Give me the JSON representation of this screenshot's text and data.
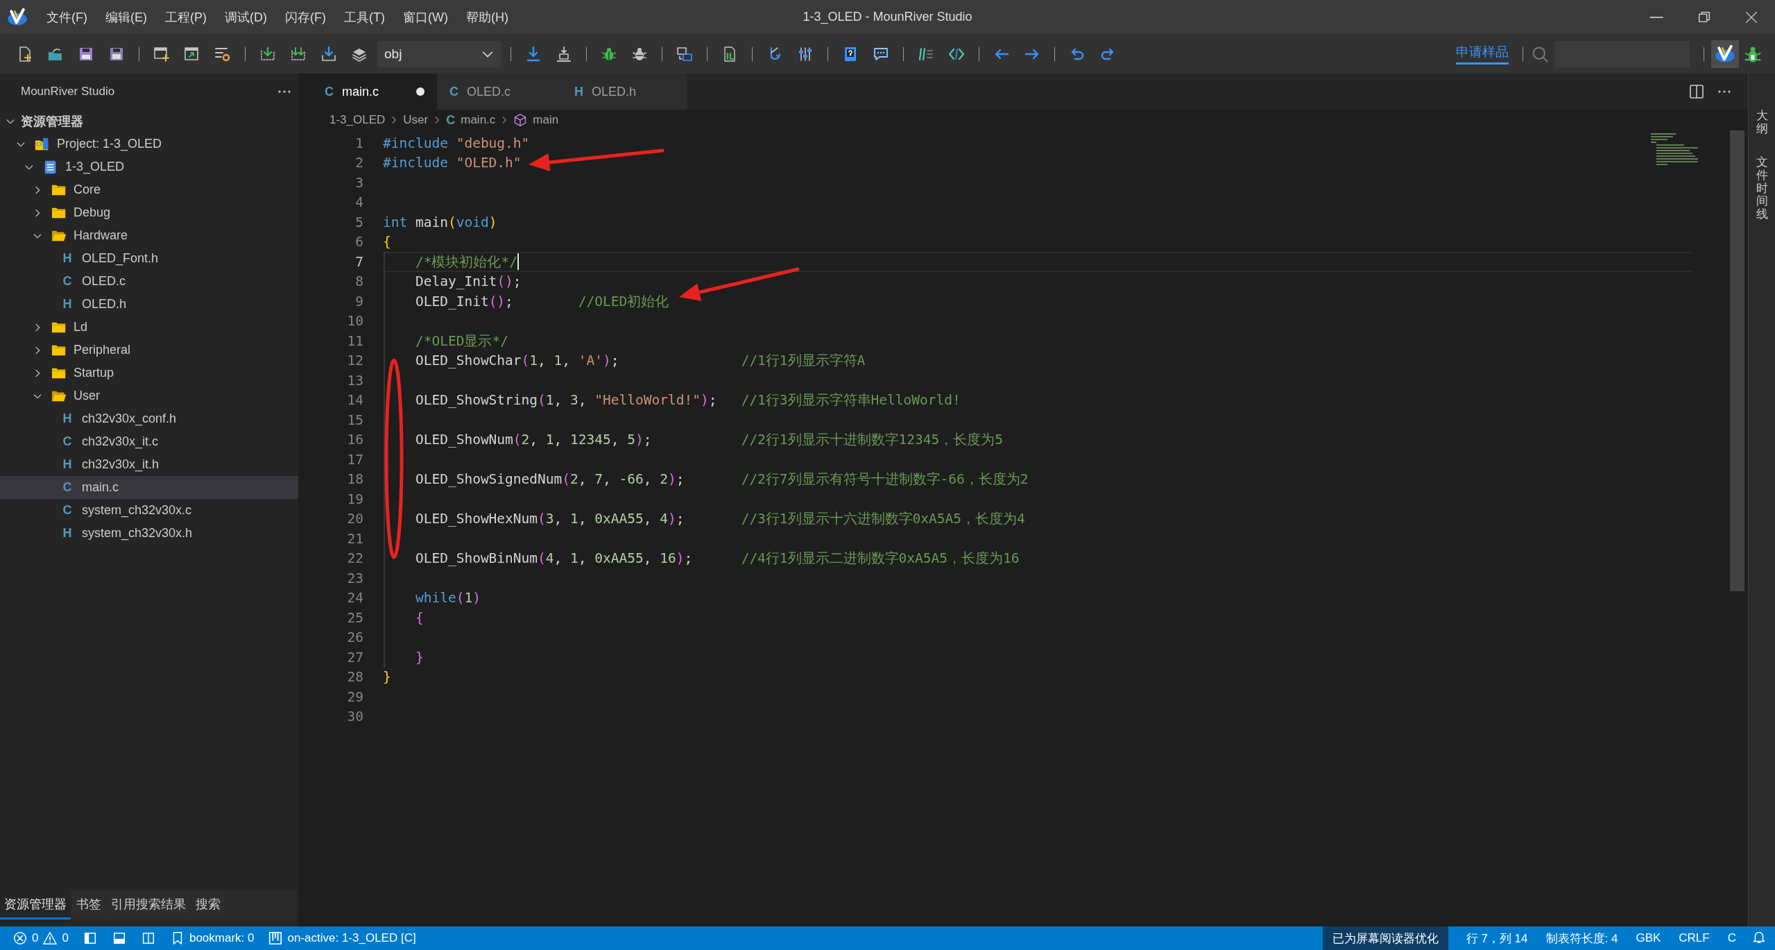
{
  "window": {
    "title": "1-3_OLED - MounRiver Studio"
  },
  "menu": [
    "文件(F)",
    "编辑(E)",
    "工程(P)",
    "调试(D)",
    "闪存(F)",
    "工具(T)",
    "窗口(W)",
    "帮助(H)"
  ],
  "toolbar": {
    "build_config": "obj",
    "sample_link": "申请样品"
  },
  "sidebar": {
    "title": "MounRiver Studio",
    "section": {
      "label": "资源管理器",
      "expanded": true
    },
    "tree": [
      {
        "label": "Project: 1-3_OLED",
        "kind": "project",
        "expanded": true,
        "selected": false,
        "children": [
          {
            "label": "1-3_OLED",
            "kind": "config",
            "expanded": true,
            "selected": false,
            "children": [
              {
                "label": "Core",
                "kind": "folder",
                "expanded": false,
                "selected": false
              },
              {
                "label": "Debug",
                "kind": "folder",
                "expanded": false,
                "selected": false
              },
              {
                "label": "Hardware",
                "kind": "folder",
                "expanded": true,
                "selected": false,
                "children": [
                  {
                    "label": "OLED_Font.h",
                    "kind": "file",
                    "icon": "H",
                    "selected": false
                  },
                  {
                    "label": "OLED.c",
                    "kind": "file",
                    "icon": "C",
                    "selected": false
                  },
                  {
                    "label": "OLED.h",
                    "kind": "file",
                    "icon": "H",
                    "selected": false
                  }
                ]
              },
              {
                "label": "Ld",
                "kind": "folder",
                "expanded": false,
                "selected": false
              },
              {
                "label": "Peripheral",
                "kind": "folder",
                "expanded": false,
                "selected": false
              },
              {
                "label": "Startup",
                "kind": "folder",
                "expanded": false,
                "selected": false
              },
              {
                "label": "User",
                "kind": "folder",
                "expanded": true,
                "selected": false,
                "children": [
                  {
                    "label": "ch32v30x_conf.h",
                    "kind": "file",
                    "icon": "H",
                    "selected": false
                  },
                  {
                    "label": "ch32v30x_it.c",
                    "kind": "file",
                    "icon": "C",
                    "selected": false
                  },
                  {
                    "label": "ch32v30x_it.h",
                    "kind": "file",
                    "icon": "H",
                    "selected": false
                  },
                  {
                    "label": "main.c",
                    "kind": "file",
                    "icon": "C",
                    "selected": true
                  },
                  {
                    "label": "system_ch32v30x.c",
                    "kind": "file",
                    "icon": "C",
                    "selected": false
                  },
                  {
                    "label": "system_ch32v30x.h",
                    "kind": "file",
                    "icon": "H",
                    "selected": false
                  }
                ]
              }
            ]
          }
        ]
      }
    ],
    "tabs": [
      {
        "label": "资源管理器",
        "selected": true
      },
      {
        "label": "书签",
        "selected": false
      },
      {
        "label": "引用搜索结果",
        "selected": false
      },
      {
        "label": "搜索",
        "selected": false
      }
    ]
  },
  "editor": {
    "tabs": [
      {
        "label": "main.c",
        "icon": "C",
        "selected": true,
        "modified": true
      },
      {
        "label": "OLED.c",
        "icon": "C",
        "selected": false,
        "modified": false
      },
      {
        "label": "OLED.h",
        "icon": "H",
        "selected": false,
        "modified": false
      }
    ],
    "breadcrumb": [
      {
        "label": "1-3_OLED",
        "kind": "folder"
      },
      {
        "label": "User",
        "kind": "folder"
      },
      {
        "label": "main.c",
        "kind": "file",
        "icon": "C"
      },
      {
        "label": "main",
        "kind": "symbol"
      }
    ],
    "lines": [
      {
        "number": "1",
        "current": false,
        "tokens": [
          {
            "kind": "keyword",
            "text": "#include"
          },
          {
            "kind": "string",
            "text": " \"debug.h\""
          }
        ]
      },
      {
        "number": "2",
        "current": false,
        "tokens": [
          {
            "kind": "keyword",
            "text": "#include"
          },
          {
            "kind": "string",
            "text": " \"OLED.h\""
          }
        ]
      },
      {
        "number": "3",
        "current": false
      },
      {
        "number": "4",
        "current": false
      },
      {
        "number": "5",
        "current": false,
        "tokens": [
          {
            "kind": "keyword",
            "text": "int"
          },
          {
            "kind": "plain",
            "text": " main"
          },
          {
            "kind": "bracket1",
            "text": "("
          },
          {
            "kind": "keyword",
            "text": "void"
          },
          {
            "kind": "bracket1",
            "text": ")"
          }
        ]
      },
      {
        "number": "6",
        "current": false,
        "tokens": [
          {
            "kind": "bracket1",
            "text": "{"
          }
        ]
      },
      {
        "number": "7",
        "current": true,
        "tokens": [
          {
            "kind": "comment",
            "text": "    /*模块初始化*/"
          }
        ]
      },
      {
        "number": "8",
        "current": false,
        "tokens": [
          {
            "kind": "plain",
            "text": "    Delay_Init"
          },
          {
            "kind": "bracket2",
            "text": "()"
          },
          {
            "kind": "plain",
            "text": ";"
          }
        ]
      },
      {
        "number": "9",
        "current": false,
        "tokens": [
          {
            "kind": "plain",
            "text": "    OLED_Init"
          },
          {
            "kind": "bracket2",
            "text": "()"
          },
          {
            "kind": "plain",
            "text": ";        "
          },
          {
            "kind": "comment",
            "text": "//OLED初始化"
          }
        ]
      },
      {
        "number": "10",
        "current": false
      },
      {
        "number": "11",
        "current": false,
        "tokens": [
          {
            "kind": "comment",
            "text": "    /*OLED显示*/"
          }
        ]
      },
      {
        "number": "12",
        "current": false,
        "tokens": [
          {
            "kind": "plain",
            "text": "    OLED_ShowChar"
          },
          {
            "kind": "bracket2",
            "text": "("
          },
          {
            "kind": "number",
            "text": "1"
          },
          {
            "kind": "plain",
            "text": ", "
          },
          {
            "kind": "number",
            "text": "1"
          },
          {
            "kind": "plain",
            "text": ", "
          },
          {
            "kind": "string",
            "text": "'A'"
          },
          {
            "kind": "bracket2",
            "text": ")"
          },
          {
            "kind": "plain",
            "text": ";               "
          },
          {
            "kind": "comment",
            "text": "//1行1列显示字符A"
          }
        ]
      },
      {
        "number": "13",
        "current": false
      },
      {
        "number": "14",
        "current": false,
        "tokens": [
          {
            "kind": "plain",
            "text": "    OLED_ShowString"
          },
          {
            "kind": "bracket2",
            "text": "("
          },
          {
            "kind": "number",
            "text": "1"
          },
          {
            "kind": "plain",
            "text": ", "
          },
          {
            "kind": "number",
            "text": "3"
          },
          {
            "kind": "plain",
            "text": ", "
          },
          {
            "kind": "string",
            "text": "\"HelloWorld!\""
          },
          {
            "kind": "bracket2",
            "text": ")"
          },
          {
            "kind": "plain",
            "text": ";   "
          },
          {
            "kind": "comment",
            "text": "//1行3列显示字符串HelloWorld!"
          }
        ]
      },
      {
        "number": "15",
        "current": false
      },
      {
        "number": "16",
        "current": false,
        "tokens": [
          {
            "kind": "plain",
            "text": "    OLED_ShowNum"
          },
          {
            "kind": "bracket2",
            "text": "("
          },
          {
            "kind": "number",
            "text": "2"
          },
          {
            "kind": "plain",
            "text": ", "
          },
          {
            "kind": "number",
            "text": "1"
          },
          {
            "kind": "plain",
            "text": ", "
          },
          {
            "kind": "number",
            "text": "12345"
          },
          {
            "kind": "plain",
            "text": ", "
          },
          {
            "kind": "number",
            "text": "5"
          },
          {
            "kind": "bracket2",
            "text": ")"
          },
          {
            "kind": "plain",
            "text": ";           "
          },
          {
            "kind": "comment",
            "text": "//2行1列显示十进制数字12345，长度为5"
          }
        ]
      },
      {
        "number": "17",
        "current": false
      },
      {
        "number": "18",
        "current": false,
        "tokens": [
          {
            "kind": "plain",
            "text": "    OLED_ShowSignedNum"
          },
          {
            "kind": "bracket2",
            "text": "("
          },
          {
            "kind": "number",
            "text": "2"
          },
          {
            "kind": "plain",
            "text": ", "
          },
          {
            "kind": "number",
            "text": "7"
          },
          {
            "kind": "plain",
            "text": ", "
          },
          {
            "kind": "number",
            "text": "-66"
          },
          {
            "kind": "plain",
            "text": ", "
          },
          {
            "kind": "number",
            "text": "2"
          },
          {
            "kind": "bracket2",
            "text": ")"
          },
          {
            "kind": "plain",
            "text": ";       "
          },
          {
            "kind": "comment",
            "text": "//2行7列显示有符号十进制数字-66，长度为2"
          }
        ]
      },
      {
        "number": "19",
        "current": false
      },
      {
        "number": "20",
        "current": false,
        "tokens": [
          {
            "kind": "plain",
            "text": "    OLED_ShowHexNum"
          },
          {
            "kind": "bracket2",
            "text": "("
          },
          {
            "kind": "number",
            "text": "3"
          },
          {
            "kind": "plain",
            "text": ", "
          },
          {
            "kind": "number",
            "text": "1"
          },
          {
            "kind": "plain",
            "text": ", "
          },
          {
            "kind": "number",
            "text": "0xAA55"
          },
          {
            "kind": "plain",
            "text": ", "
          },
          {
            "kind": "number",
            "text": "4"
          },
          {
            "kind": "bracket2",
            "text": ")"
          },
          {
            "kind": "plain",
            "text": ";       "
          },
          {
            "kind": "comment",
            "text": "//3行1列显示十六进制数字0xA5A5，长度为4"
          }
        ]
      },
      {
        "number": "21",
        "current": false
      },
      {
        "number": "22",
        "current": false,
        "tokens": [
          {
            "kind": "plain",
            "text": "    OLED_ShowBinNum"
          },
          {
            "kind": "bracket2",
            "text": "("
          },
          {
            "kind": "number",
            "text": "4"
          },
          {
            "kind": "plain",
            "text": ", "
          },
          {
            "kind": "number",
            "text": "1"
          },
          {
            "kind": "plain",
            "text": ", "
          },
          {
            "kind": "number",
            "text": "0xAA55"
          },
          {
            "kind": "plain",
            "text": ", "
          },
          {
            "kind": "number",
            "text": "16"
          },
          {
            "kind": "bracket2",
            "text": ")"
          },
          {
            "kind": "plain",
            "text": ";      "
          },
          {
            "kind": "comment",
            "text": "//4行1列显示二进制数字0xA5A5，长度为16"
          }
        ]
      },
      {
        "number": "23",
        "current": false
      },
      {
        "number": "24",
        "current": false,
        "tokens": [
          {
            "kind": "keyword",
            "text": "    while"
          },
          {
            "kind": "bracket2",
            "text": "("
          },
          {
            "kind": "number",
            "text": "1"
          },
          {
            "kind": "bracket2",
            "text": ")"
          }
        ]
      },
      {
        "number": "25",
        "current": false,
        "tokens": [
          {
            "kind": "bracket2",
            "text": "    {"
          }
        ]
      },
      {
        "number": "26",
        "current": false
      },
      {
        "number": "27",
        "current": false,
        "tokens": [
          {
            "kind": "bracket2",
            "text": "    }"
          }
        ]
      },
      {
        "number": "28",
        "current": false,
        "tokens": [
          {
            "kind": "bracket1",
            "text": "}"
          }
        ]
      },
      {
        "number": "29",
        "current": false
      },
      {
        "number": "30",
        "current": false
      }
    ],
    "annotations": [
      {
        "kind": "arrow"
      },
      {
        "kind": "arrow"
      },
      {
        "kind": "ellipse"
      }
    ]
  },
  "right_panel": {
    "tabs": [
      "大纲",
      "文件时间线"
    ]
  },
  "status_bar": {
    "left": [
      {
        "kind": "problems",
        "errors": "0",
        "warnings": "0"
      },
      {
        "kind": "layout-left"
      },
      {
        "kind": "layout-bottom"
      },
      {
        "kind": "layout-right"
      },
      {
        "kind": "bookmark",
        "text": "bookmark: 0"
      },
      {
        "kind": "board",
        "text": "on-active: 1-3_OLED [C]"
      }
    ],
    "right": [
      {
        "kind": "mode",
        "text": "已为屏幕阅读器优化"
      },
      {
        "kind": "text",
        "text": "行 7，列 14"
      },
      {
        "kind": "text",
        "text": "制表符长度: 4"
      },
      {
        "kind": "text",
        "text": "GBK"
      },
      {
        "kind": "text",
        "text": "CRLF"
      },
      {
        "kind": "text",
        "text": "C"
      },
      {
        "kind": "bell"
      }
    ]
  }
}
